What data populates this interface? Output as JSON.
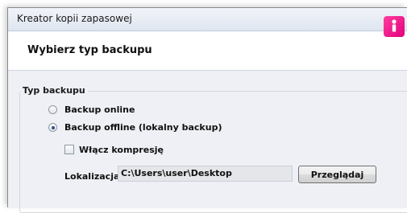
{
  "window": {
    "title": "Kreator kopii zapasowej"
  },
  "header": {
    "title": "Wybierz typ backupu",
    "icon": "lock-shield-icon",
    "icon_color": "#e8007f"
  },
  "group": {
    "legend": "Typ backupu"
  },
  "options": {
    "online_label": "Backup online",
    "online_selected": false,
    "offline_label": "Backup offline (lokalny backup)",
    "offline_selected": true
  },
  "compression": {
    "label": "Włącz kompresję",
    "checked": false
  },
  "location": {
    "label": "Lokalizacja:",
    "value": "C:\\Users\\user\\Desktop",
    "browse_label": "Przeglądaj"
  }
}
